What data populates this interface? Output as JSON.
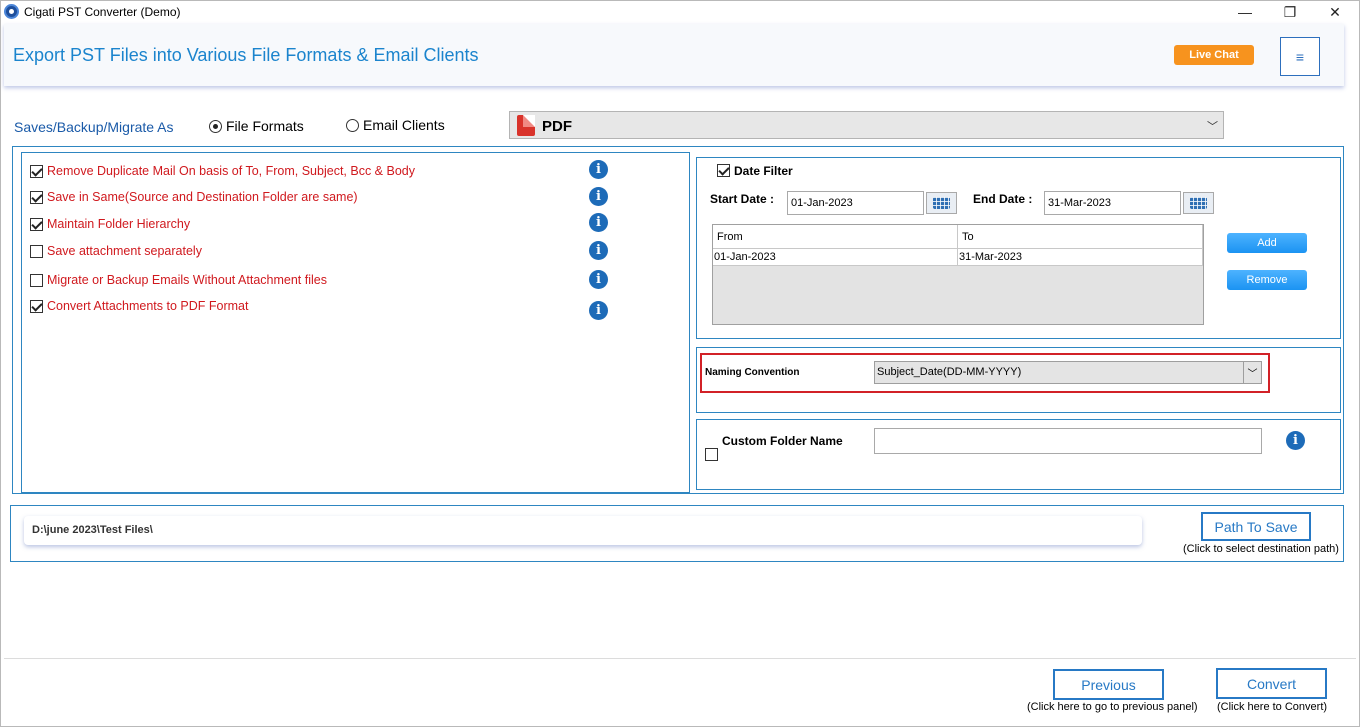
{
  "window": {
    "title": "Cigati PST Converter (Demo)",
    "minimize_glyph": "—",
    "maximize_glyph": "❐",
    "close_glyph": "✕"
  },
  "header": {
    "title": "Export PST Files into Various File Formats & Email Clients",
    "live_chat": "Live Chat",
    "menu_glyph": "≡"
  },
  "save_as": {
    "label": "Saves/Backup/Migrate As",
    "options": [
      {
        "label": "File Formats",
        "selected": true
      },
      {
        "label": "Email Clients",
        "selected": false
      }
    ],
    "format_selected": "PDF",
    "format_icon": "pdf-file-icon"
  },
  "options": [
    {
      "label": "Remove Duplicate Mail On basis of To, From, Subject, Bcc & Body",
      "checked": true
    },
    {
      "label": "Save in Same(Source and Destination Folder are same)",
      "checked": true
    },
    {
      "label": "Maintain Folder Hierarchy",
      "checked": true
    },
    {
      "label": "Save attachment separately",
      "checked": false
    },
    {
      "label": "Migrate or Backup Emails Without Attachment files",
      "checked": false
    },
    {
      "label": "Convert Attachments to PDF Format",
      "checked": true
    }
  ],
  "info_glyph": "i",
  "date_filter": {
    "label": "Date Filter",
    "checked": true,
    "start_label": "Start Date :",
    "start_value": "01-Jan-2023",
    "end_label": "End Date :",
    "end_value": "31-Mar-2023",
    "table_headers": [
      "From",
      "To"
    ],
    "table_rows": [
      [
        "01-Jan-2023",
        "31-Mar-2023"
      ]
    ],
    "add_label": "Add",
    "remove_label": "Remove"
  },
  "naming": {
    "label": "Naming Convention",
    "selected": "Subject_Date(DD-MM-YYYY)"
  },
  "custom_folder": {
    "label": "Custom Folder Name",
    "checked": false,
    "value": ""
  },
  "path": {
    "value": "D:\\june 2023\\Test Files\\",
    "button_label": "Path To Save",
    "hint": "(Click to select destination path)"
  },
  "footer": {
    "previous_label": "Previous",
    "previous_hint": "(Click here to go to previous panel)",
    "convert_label": "Convert",
    "convert_hint": "(Click here to Convert)"
  },
  "colors": {
    "accent_blue": "#2779c5",
    "option_red": "#d0191e",
    "live_chat_orange": "#f7931e",
    "naming_highlight": "#d22127"
  }
}
